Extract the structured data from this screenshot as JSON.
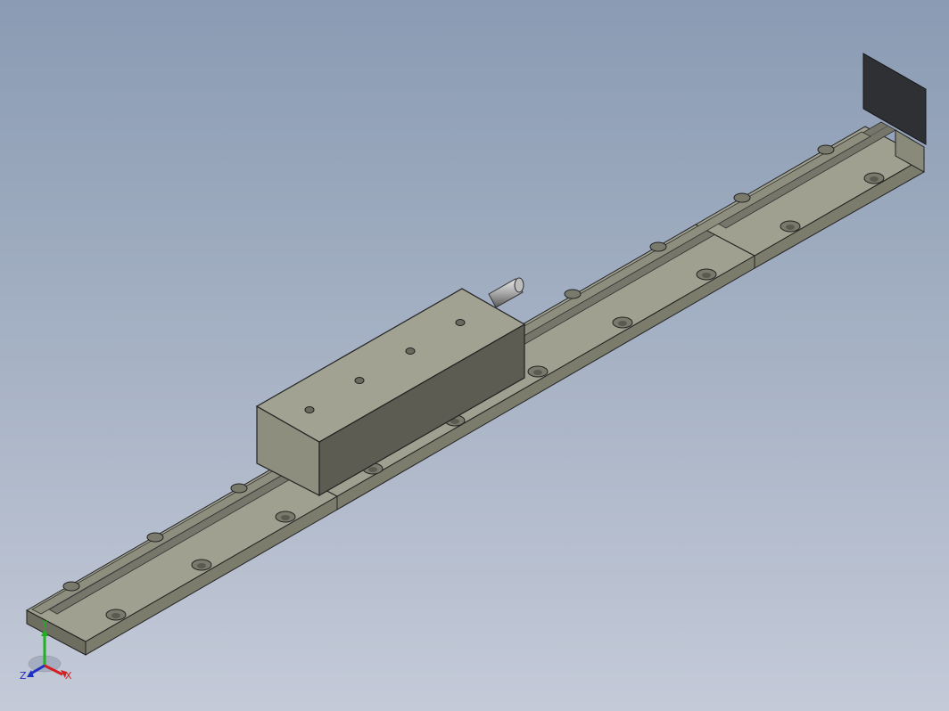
{
  "viewport": {
    "background_top": "#8a9bb3",
    "background_bottom": "#c4cad8",
    "model_color": "#9e9e8e"
  },
  "triad": {
    "x_label": "X",
    "y_label": "Y",
    "z_label": "Z",
    "x_color": "#d42020",
    "y_color": "#20b020",
    "z_color": "#2030c0"
  }
}
